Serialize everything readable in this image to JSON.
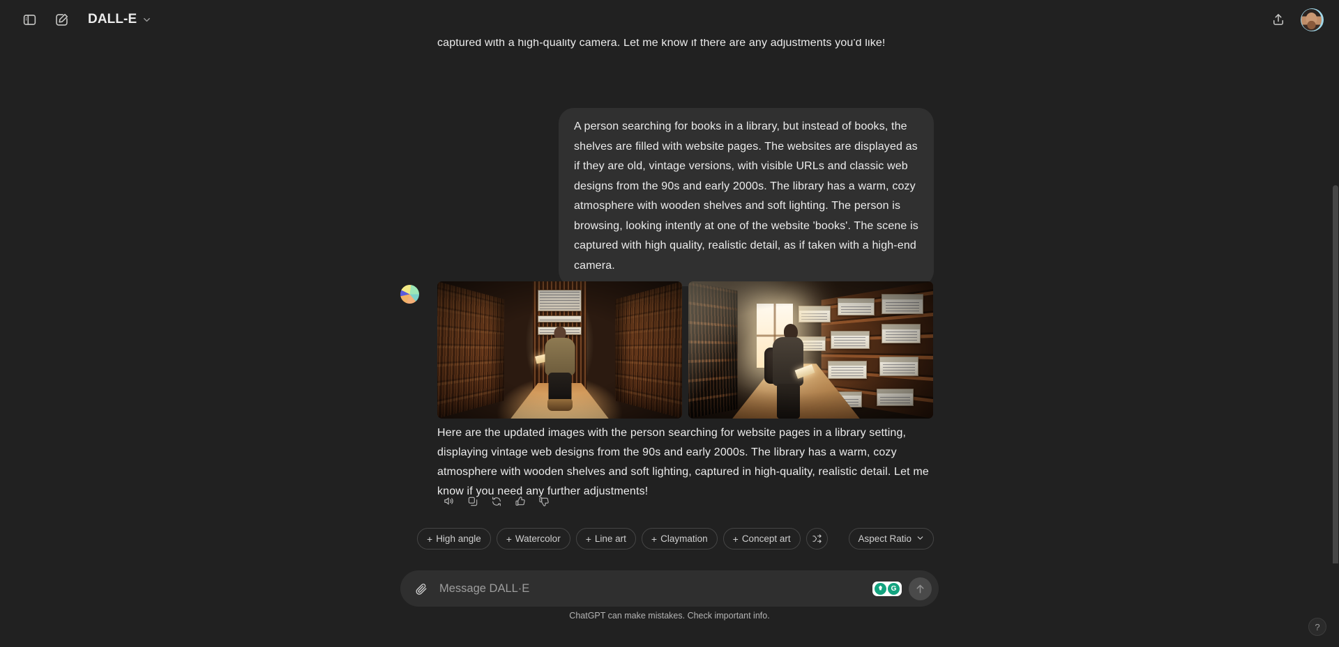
{
  "header": {
    "sidebar_toggle_icon": "sidebar-panel-icon",
    "new_chat_icon": "pencil-square-icon",
    "model_name": "DALL-E",
    "model_chevron_icon": "chevron-down-icon",
    "share_icon": "share-upload-icon",
    "avatar_icon": "user-avatar"
  },
  "conversation": {
    "assistant_intro": "Here are the images you requested, depicting a person browsing through a library where the books are actually old versions of websites. The scene is designed to look highly realistic, as if captured with a high-quality camera. Let me know if there are any adjustments you'd like!",
    "user_message": "A person searching for books in a library, but instead of books, the shelves are filled with website pages. The websites are displayed as if they are old, vintage versions, with visible URLs and classic web designs from the 90s and early 2000s. The library has a warm, cozy atmosphere with wooden shelves and soft lighting. The person is browsing, looking intently at one of the website 'books'. The scene is captured with high quality, realistic detail, as if taken with a high-end camera.",
    "assistant_final": "Here are the updated images with the person searching for website pages in a library setting, displaying vintage web designs from the 90s and early 2000s. The library has a warm, cozy atmosphere with wooden shelves and soft lighting, captured in high-quality, realistic detail. Let me know if you need any further adjustments!",
    "assistant_avatar_name": "dalle-logo",
    "images": [
      {
        "alt": "Library aisle with wooden shelves and a person standing in the glowing center corridor"
      },
      {
        "alt": "Person with a backpack browsing shelves filled with vintage website pages lit by a window"
      }
    ]
  },
  "actions": [
    {
      "name": "read-aloud",
      "icon": "speaker-icon"
    },
    {
      "name": "copy",
      "icon": "copy-icon"
    },
    {
      "name": "regenerate",
      "icon": "refresh-icon"
    },
    {
      "name": "thumbs-up",
      "icon": "thumbs-up-icon"
    },
    {
      "name": "thumbs-down",
      "icon": "thumbs-down-icon"
    }
  ],
  "suggestions": {
    "chips": [
      {
        "prefix": "+",
        "label": "High angle"
      },
      {
        "prefix": "+",
        "label": "Watercolor"
      },
      {
        "prefix": "+",
        "label": "Line art"
      },
      {
        "prefix": "+",
        "label": "Claymation"
      },
      {
        "prefix": "+",
        "label": "Concept art"
      }
    ],
    "shuffle_icon": "shuffle-icon",
    "aspect_ratio_label": "Aspect Ratio",
    "aspect_ratio_chevron": "chevron-down-icon"
  },
  "composer": {
    "attach_icon": "paperclip-icon",
    "placeholder": "Message DALL·E",
    "value": "",
    "extension_icons": [
      "grammarly-bulb-icon",
      "grammarly-g-icon"
    ],
    "send_icon": "arrow-up-icon",
    "accent_green": "#13a37f"
  },
  "footer": {
    "disclaimer": "ChatGPT can make mistakes. Check important info.",
    "help_label": "?"
  },
  "theme": {
    "page_bg": "#212121",
    "bubble_bg": "#303030",
    "composer_bg": "#2f2f2f",
    "text_primary": "#ececec",
    "text_muted": "#b4b4b4"
  }
}
